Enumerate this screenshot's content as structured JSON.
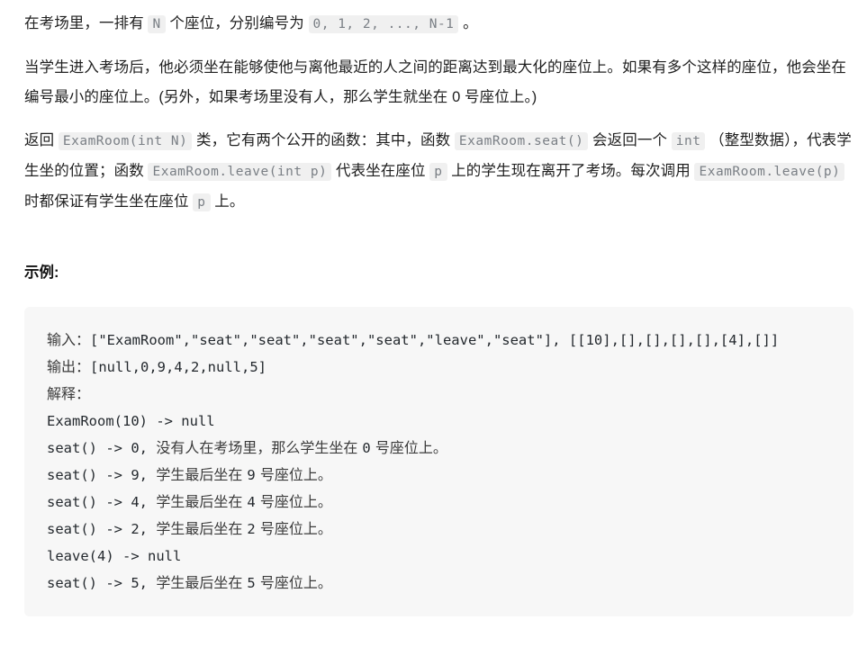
{
  "document": {
    "paragraphs": [
      {
        "id": "paragraph-seats",
        "parts": [
          {
            "type": "text",
            "value": "在考场里，一排有 "
          },
          {
            "type": "code",
            "value": "N"
          },
          {
            "type": "text",
            "value": " 个座位，分别编号为 "
          },
          {
            "type": "code",
            "value": "0, 1, 2, ..., N-1"
          },
          {
            "type": "text",
            "value": " 。"
          }
        ]
      },
      {
        "id": "paragraph-rule",
        "parts": [
          {
            "type": "text",
            "value": "当学生进入考场后，他必须坐在能够使他与离他最近的人之间的距离达到最大化的座位上。如果有多个这样的座位，他会坐在编号最小的座位上。(另外，如果考场里没有人，那么学生就坐在 0 号座位上。)"
          }
        ]
      },
      {
        "id": "paragraph-api",
        "parts": [
          {
            "type": "text",
            "value": "返回 "
          },
          {
            "type": "code",
            "value": "ExamRoom(int N)"
          },
          {
            "type": "text",
            "value": " 类，它有两个公开的函数：其中，函数 "
          },
          {
            "type": "code",
            "value": "ExamRoom.seat()"
          },
          {
            "type": "text",
            "value": " 会返回一个 "
          },
          {
            "type": "code",
            "value": "int"
          },
          {
            "type": "text",
            "value": " （整型数据），代表学生坐的位置；函数 "
          },
          {
            "type": "code",
            "value": "ExamRoom.leave(int p)"
          },
          {
            "type": "text",
            "value": " 代表坐在座位 "
          },
          {
            "type": "code",
            "value": "p"
          },
          {
            "type": "text",
            "value": " 上的学生现在离开了考场。每次调用 "
          },
          {
            "type": "code",
            "value": "ExamRoom.leave(p)"
          },
          {
            "type": "text",
            "value": " 时都保证有学生坐在座位 "
          },
          {
            "type": "code",
            "value": "p"
          },
          {
            "type": "text",
            "value": " 上。"
          }
        ]
      }
    ],
    "example_heading": "示例:",
    "example_block": {
      "lines": [
        [
          {
            "type": "cjk",
            "value": "输入："
          },
          {
            "type": "mono",
            "value": "[\"ExamRoom\",\"seat\",\"seat\",\"seat\",\"seat\",\"leave\",\"seat\"], [[10],[],[],[],[],[4],[]]"
          }
        ],
        [
          {
            "type": "cjk",
            "value": "输出："
          },
          {
            "type": "mono",
            "value": "[null,0,9,4,2,null,5]"
          }
        ],
        [
          {
            "type": "cjk",
            "value": "解释："
          }
        ],
        [
          {
            "type": "mono",
            "value": "ExamRoom(10) -> null"
          }
        ],
        [
          {
            "type": "mono",
            "value": "seat() -> 0, "
          },
          {
            "type": "cjk",
            "value": "没有人在考场里，那么学生坐在 "
          },
          {
            "type": "mono",
            "value": "0"
          },
          {
            "type": "cjk",
            "value": " 号座位上。"
          }
        ],
        [
          {
            "type": "mono",
            "value": "seat() -> 9, "
          },
          {
            "type": "cjk",
            "value": "学生最后坐在 "
          },
          {
            "type": "mono",
            "value": "9"
          },
          {
            "type": "cjk",
            "value": " 号座位上。"
          }
        ],
        [
          {
            "type": "mono",
            "value": "seat() -> 4, "
          },
          {
            "type": "cjk",
            "value": "学生最后坐在 "
          },
          {
            "type": "mono",
            "value": "4"
          },
          {
            "type": "cjk",
            "value": " 号座位上。"
          }
        ],
        [
          {
            "type": "mono",
            "value": "seat() -> 2, "
          },
          {
            "type": "cjk",
            "value": "学生最后坐在 "
          },
          {
            "type": "mono",
            "value": "2"
          },
          {
            "type": "cjk",
            "value": " 号座位上。"
          }
        ],
        [
          {
            "type": "mono",
            "value": "leave(4) -> null"
          }
        ],
        [
          {
            "type": "mono",
            "value": "seat() -> 5, "
          },
          {
            "type": "cjk",
            "value": "学生最后坐在 "
          },
          {
            "type": "mono",
            "value": "5"
          },
          {
            "type": "cjk",
            "value": " 号座位上。"
          }
        ]
      ]
    }
  },
  "colors": {
    "page_background": "#ffffff",
    "body_text": "#1f1f1f",
    "inline_code_background": "#f0f0f0",
    "inline_code_text": "#7a7f85",
    "codeblock_background": "#f7f7f7",
    "codeblock_mono_text": "#24292e",
    "codeblock_cjk_text": "#3b3b3b"
  }
}
